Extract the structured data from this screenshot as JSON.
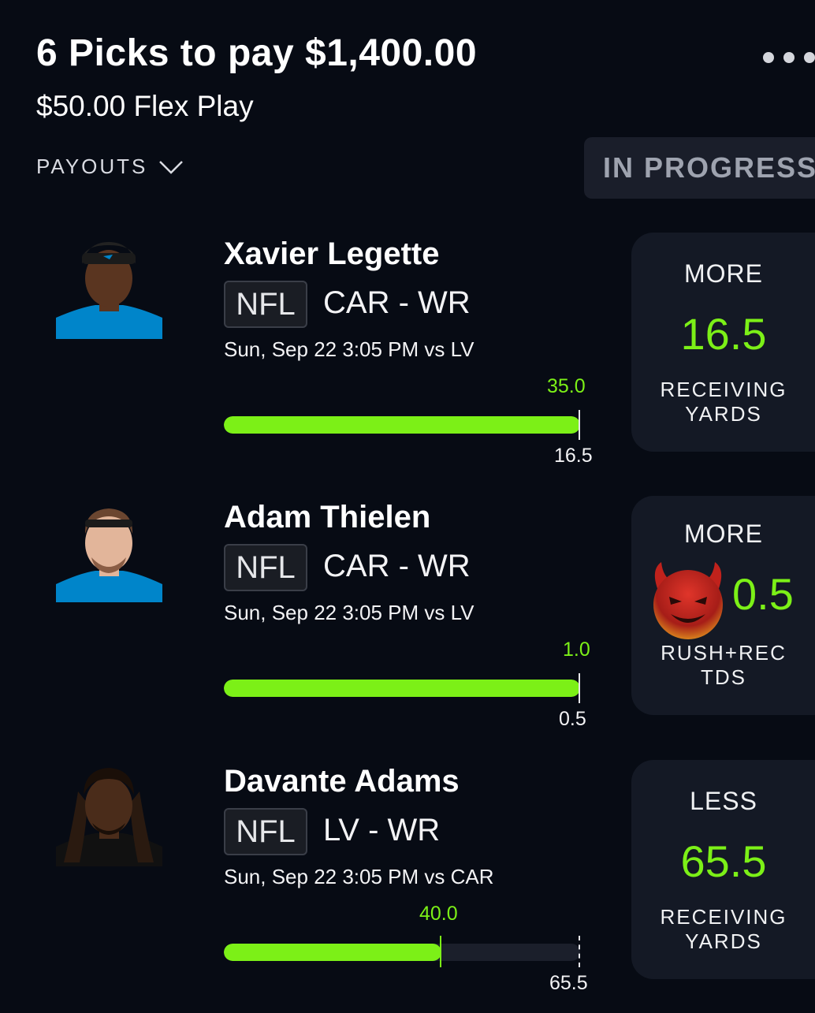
{
  "header": {
    "title": "6 Picks to pay $1,400.00",
    "subtitle": "$50.00 Flex Play",
    "payouts_label": "PAYOUTS",
    "status": "IN PROGRESS"
  },
  "picks": [
    {
      "name": "Xavier Legette",
      "league": "NFL",
      "team_pos": "CAR - WR",
      "game": "Sun, Sep 22 3:05 PM  vs LV",
      "actual": "35.0",
      "line": "16.5",
      "progress_fraction": 1.0,
      "direction": "MORE",
      "stat_line": [
        "RECEIVING",
        "YARDS"
      ],
      "jersey_color": "#0085ca"
    },
    {
      "name": "Adam Thielen",
      "league": "NFL",
      "team_pos": "CAR - WR",
      "game": "Sun, Sep 22 3:05 PM  vs LV",
      "actual": "1.0",
      "line": "0.5",
      "progress_fraction": 1.0,
      "direction": "MORE",
      "stat_line": [
        "RUSH+REC",
        "TDS"
      ],
      "jersey_color": "#0085ca",
      "badge_icon": "devil-emoji-icon"
    },
    {
      "name": "Davante Adams",
      "league": "NFL",
      "team_pos": "LV - WR",
      "game": "Sun, Sep 22 3:05 PM  vs CAR",
      "actual": "40.0",
      "line": "65.5",
      "progress_fraction": 0.61,
      "direction": "LESS",
      "stat_line": [
        "RECEIVING",
        "YARDS"
      ],
      "jersey_color": "#111111"
    }
  ],
  "colors": {
    "background": "#070b14",
    "accent_green": "#7cf017",
    "card": "#141925",
    "badge": "#1a1e2a"
  }
}
